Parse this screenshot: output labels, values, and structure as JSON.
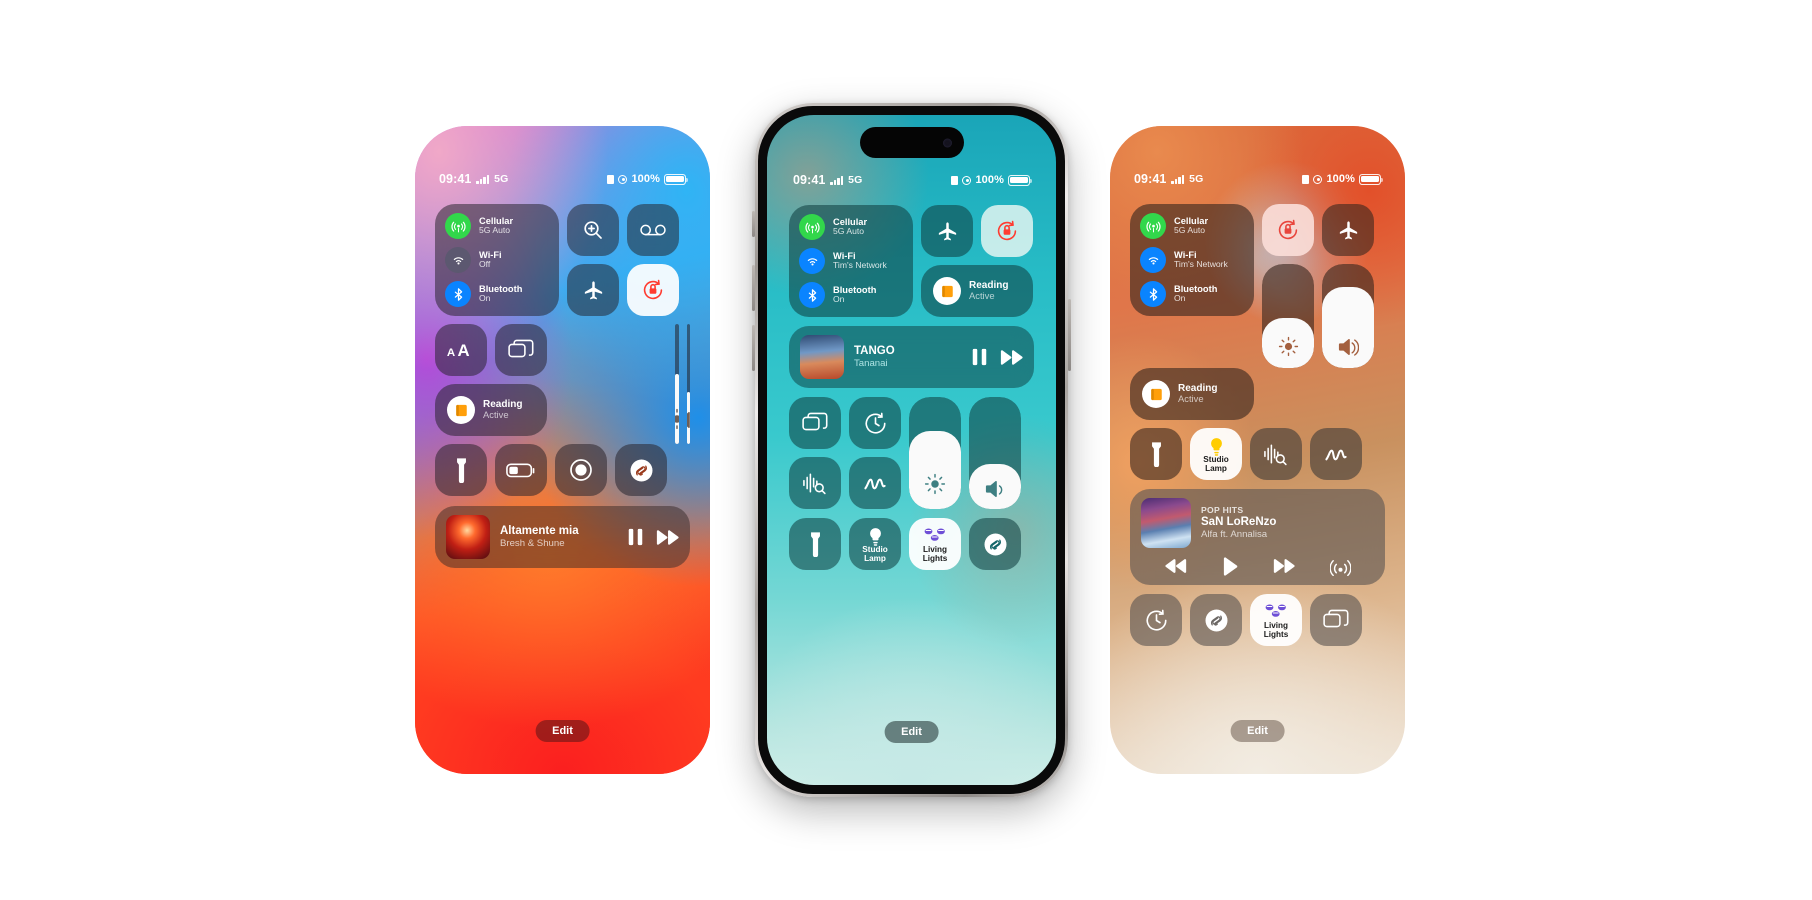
{
  "meta": {
    "screen": "iOS Control Center — three iPhone mockups",
    "background_color": "#ffffff"
  },
  "status_bar": {
    "time": "09:41",
    "network": "5G",
    "battery_percent": "100%",
    "signal_icon": "cellular-bars-icon",
    "focus_icon": "focus-reading-icon",
    "lock_icon": "orientation-lock-status-icon",
    "battery_icon": "battery-full-icon"
  },
  "phones": [
    {
      "id": "phone-left",
      "theme": "pink-blue-red-gradient",
      "has_frame": false,
      "connectivity": {
        "cellular": {
          "label": "Cellular",
          "value": "5G Auto",
          "icon": "cellular-antenna-icon",
          "color": "#32d74b",
          "on": true
        },
        "wifi": {
          "label": "Wi-Fi",
          "value": "Off",
          "icon": "wifi-icon",
          "color": "#5c5870",
          "on": false
        },
        "bluetooth": {
          "label": "Bluetooth",
          "value": "On",
          "icon": "bluetooth-icon",
          "color": "#0a84ff",
          "on": true
        }
      },
      "tiles_top": [
        {
          "name": "magnifier-tile",
          "icon": "magnifier-plus-icon",
          "state": "off"
        },
        {
          "name": "voicemail-tile",
          "icon": "voicemail-icon",
          "state": "off"
        },
        {
          "name": "airplane-mode-tile",
          "icon": "airplane-icon",
          "state": "off"
        },
        {
          "name": "orientation-lock-tile",
          "icon": "rotation-lock-icon",
          "state": "on"
        }
      ],
      "tiles_mid": [
        {
          "name": "text-size-tile",
          "icon": "text-size-icon",
          "state": "off"
        },
        {
          "name": "screen-mirror-tile",
          "icon": "screen-mirror-icon",
          "state": "off"
        }
      ],
      "focus": {
        "label": "Reading",
        "status": "Active",
        "icon": "book-icon",
        "accent": "#ff9f0a"
      },
      "sliders": {
        "brightness": {
          "name": "brightness-slider",
          "icon": "brightness-icon",
          "value_percent": 58
        },
        "volume": {
          "name": "volume-slider",
          "icon": "volume-icon",
          "value_percent": 43
        }
      },
      "tiles_bottom": [
        {
          "name": "flashlight-tile",
          "icon": "flashlight-icon",
          "state": "off"
        },
        {
          "name": "low-power-mode-tile",
          "icon": "low-power-battery-icon",
          "state": "off"
        },
        {
          "name": "screen-record-tile",
          "icon": "screen-record-icon",
          "state": "off"
        },
        {
          "name": "shazam-tile",
          "icon": "shazam-icon",
          "state": "off"
        }
      ],
      "now_playing": {
        "title": "Altamente mia",
        "artist": "Bresh & Shune",
        "eyebrow": "",
        "artwork": "album-art-red",
        "controls": [
          "pause-button",
          "fast-forward-button"
        ]
      },
      "edit_label": "Edit"
    },
    {
      "id": "phone-center",
      "theme": "teal-gradient",
      "has_frame": true,
      "connectivity": {
        "cellular": {
          "label": "Cellular",
          "value": "5G Auto",
          "icon": "cellular-antenna-icon",
          "color": "#32d74b",
          "on": true
        },
        "wifi": {
          "label": "Wi-Fi",
          "value": "Tim's Network",
          "icon": "wifi-icon",
          "color": "#0a84ff",
          "on": true
        },
        "bluetooth": {
          "label": "Bluetooth",
          "value": "On",
          "icon": "bluetooth-icon",
          "color": "#0a84ff",
          "on": true
        }
      },
      "tiles_top": [
        {
          "name": "airplane-mode-tile",
          "icon": "airplane-icon",
          "state": "off"
        },
        {
          "name": "orientation-lock-tile",
          "icon": "rotation-lock-icon",
          "state": "on"
        }
      ],
      "focus": {
        "label": "Reading",
        "status": "Active",
        "icon": "book-icon",
        "accent": "#ff9f0a"
      },
      "now_playing": {
        "title": "TANGO",
        "artist": "Tananai",
        "eyebrow": "",
        "artwork": "album-art-runner",
        "controls": [
          "pause-button",
          "fast-forward-button"
        ]
      },
      "tiles_mid": [
        {
          "name": "screen-mirror-tile",
          "icon": "screen-mirror-icon",
          "state": "off"
        },
        {
          "name": "timer-tile",
          "icon": "timer-icon",
          "state": "off"
        },
        {
          "name": "sound-recognition-tile",
          "icon": "sound-recognition-icon",
          "state": "off"
        },
        {
          "name": "quick-note-tile",
          "icon": "quick-note-icon",
          "state": "off"
        }
      ],
      "sliders": {
        "brightness": {
          "name": "brightness-slider",
          "icon": "brightness-icon",
          "value_percent": 70
        },
        "volume": {
          "name": "volume-slider",
          "icon": "volume-icon",
          "value_percent": 40
        }
      },
      "tiles_bottom": [
        {
          "name": "flashlight-tile",
          "icon": "flashlight-icon",
          "label": "",
          "state": "off"
        },
        {
          "name": "studio-lamp-tile",
          "icon": "lamp-icon",
          "label": "Studio\nLamp",
          "state": "off"
        },
        {
          "name": "living-lights-tile",
          "icon": "lights-icon",
          "label": "Living\nLights",
          "state": "on"
        },
        {
          "name": "shazam-tile",
          "icon": "shazam-icon",
          "label": "",
          "state": "off"
        }
      ],
      "edit_label": "Edit"
    },
    {
      "id": "phone-right",
      "theme": "orange-sand-gradient",
      "has_frame": false,
      "connectivity": {
        "cellular": {
          "label": "Cellular",
          "value": "5G Auto",
          "icon": "cellular-antenna-icon",
          "color": "#32d74b",
          "on": true
        },
        "wifi": {
          "label": "Wi-Fi",
          "value": "Tim's Network",
          "icon": "wifi-icon",
          "color": "#0a84ff",
          "on": true
        },
        "bluetooth": {
          "label": "Bluetooth",
          "value": "On",
          "icon": "bluetooth-icon",
          "color": "#0a84ff",
          "on": true
        }
      },
      "tiles_top": [
        {
          "name": "orientation-lock-tile",
          "icon": "rotation-lock-icon",
          "state": "on"
        },
        {
          "name": "airplane-mode-tile",
          "icon": "airplane-icon",
          "state": "off"
        }
      ],
      "focus": {
        "label": "Reading",
        "status": "Active",
        "icon": "book-icon",
        "accent": "#ff9f0a"
      },
      "sliders": {
        "brightness": {
          "name": "brightness-slider",
          "icon": "brightness-icon",
          "value_percent": 48
        },
        "volume": {
          "name": "volume-slider",
          "icon": "volume-icon",
          "value_percent": 78
        }
      },
      "tiles_mid": [
        {
          "name": "flashlight-tile",
          "icon": "flashlight-icon",
          "label": "",
          "state": "off"
        },
        {
          "name": "studio-lamp-tile",
          "icon": "lamp-icon",
          "label": "Studio\nLamp",
          "state": "on"
        },
        {
          "name": "sound-recognition-tile",
          "icon": "sound-recognition-icon",
          "label": "",
          "state": "off"
        },
        {
          "name": "quick-note-tile",
          "icon": "quick-note-icon",
          "label": "",
          "state": "off"
        }
      ],
      "now_playing": {
        "eyebrow": "POP HITS",
        "title": "SaN LoReNzo",
        "artist": "Alfa ft. Annalisa",
        "artwork": "album-art-mountain",
        "controls": [
          "rewind-button",
          "play-button",
          "fast-forward-button",
          "airplay-button"
        ]
      },
      "tiles_bottom": [
        {
          "name": "timer-tile",
          "icon": "timer-icon",
          "label": "",
          "state": "off"
        },
        {
          "name": "shazam-tile",
          "icon": "shazam-icon",
          "label": "",
          "state": "off"
        },
        {
          "name": "living-lights-tile",
          "icon": "lights-icon",
          "label": "Living\nLights",
          "state": "on"
        },
        {
          "name": "screen-mirror-tile",
          "icon": "screen-mirror-icon",
          "label": "",
          "state": "off"
        }
      ],
      "edit_label": "Edit"
    }
  ]
}
